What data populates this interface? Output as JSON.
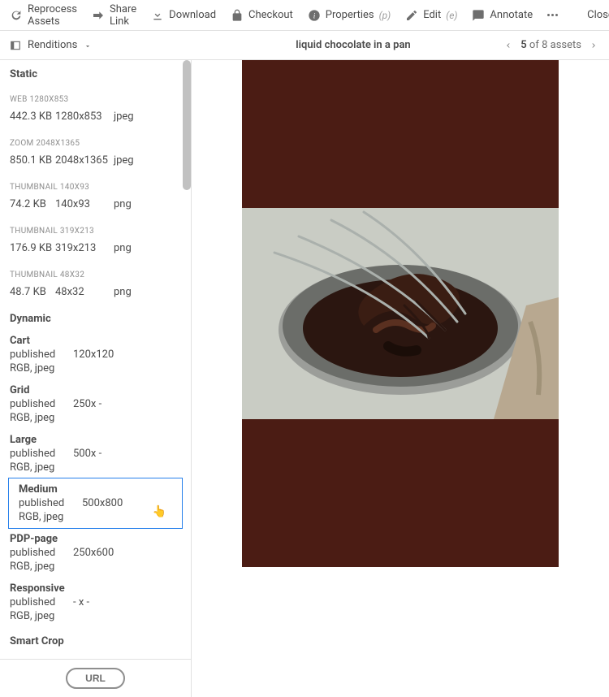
{
  "toolbar": {
    "reprocess": "Reprocess Assets",
    "share": "Share Link",
    "download": "Download",
    "checkout": "Checkout",
    "properties": "Properties",
    "properties_shortcut": "(p)",
    "edit": "Edit",
    "edit_shortcut": "(e)",
    "annotate": "Annotate",
    "close": "Close"
  },
  "subbar": {
    "renditions": "Renditions",
    "asset_title": "liquid chocolate in a pan",
    "current": "5",
    "of": "of",
    "total": "8",
    "assets": "assets"
  },
  "sidebar": {
    "static_title": "Static",
    "dynamic_title": "Dynamic",
    "smartcrop_title": "Smart Crop",
    "static": [
      {
        "label": "WEB 1280X853",
        "size": "442.3 KB",
        "dims": "1280x853",
        "fmt": "jpeg"
      },
      {
        "label": "ZOOM 2048X1365",
        "size": "850.1 KB",
        "dims": "2048x1365",
        "fmt": "jpeg"
      },
      {
        "label": "THUMBNAIL 140X93",
        "size": "74.2 KB",
        "dims": "140x93",
        "fmt": "png"
      },
      {
        "label": "THUMBNAIL 319X213",
        "size": "176.9 KB",
        "dims": "319x213",
        "fmt": "png"
      },
      {
        "label": "THUMBNAIL 48X32",
        "size": "48.7 KB",
        "dims": "48x32",
        "fmt": "png"
      }
    ],
    "dynamic": [
      {
        "name": "Cart",
        "status": "published",
        "dims": "120x120",
        "format": "RGB, jpeg"
      },
      {
        "name": "Grid",
        "status": "published",
        "dims": "250x -",
        "format": "RGB, jpeg"
      },
      {
        "name": "Large",
        "status": "published",
        "dims": "500x -",
        "format": "RGB, jpeg"
      },
      {
        "name": "Medium",
        "status": "published",
        "dims": "500x800",
        "format": "RGB, jpeg",
        "selected": true
      },
      {
        "name": "PDP-page",
        "status": "published",
        "dims": "250x600",
        "format": "RGB, jpeg"
      },
      {
        "name": "Responsive",
        "status": "published",
        "dims": "- x -",
        "format": "RGB, jpeg"
      }
    ],
    "url_button": "URL"
  }
}
